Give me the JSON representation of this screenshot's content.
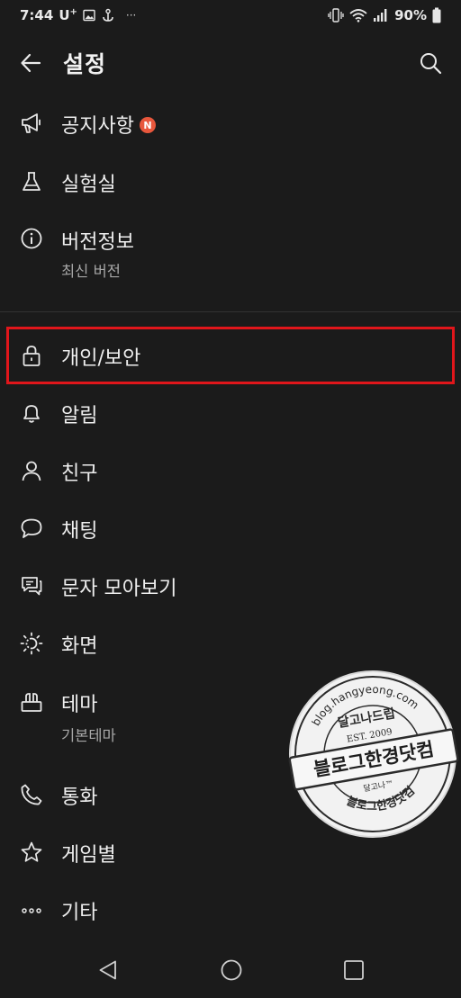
{
  "status_bar": {
    "time": "7:44",
    "carrier": "U",
    "carrier_sup": "+",
    "battery_percent": "90%",
    "dots": "···"
  },
  "header": {
    "title": "설정"
  },
  "menu": [
    {
      "label": "공지사항",
      "badge": "N",
      "icon": "megaphone-icon"
    },
    {
      "label": "실험실",
      "icon": "flask-icon"
    },
    {
      "label": "버전정보",
      "sub": "최신 버전",
      "icon": "info-icon"
    },
    {
      "label": "개인/보안",
      "icon": "lock-icon",
      "highlighted": true
    },
    {
      "label": "알림",
      "icon": "bell-icon"
    },
    {
      "label": "친구",
      "icon": "person-icon"
    },
    {
      "label": "채팅",
      "icon": "chat-bubble-icon"
    },
    {
      "label": "문자 모아보기",
      "icon": "message-collection-icon"
    },
    {
      "label": "화면",
      "icon": "brightness-icon"
    },
    {
      "label": "테마",
      "sub": "기본테마",
      "icon": "theme-brush-icon"
    },
    {
      "label": "통화",
      "icon": "phone-icon"
    },
    {
      "label": "게임별",
      "icon": "star-icon"
    },
    {
      "label": "기타",
      "icon": "more-dots-icon"
    }
  ],
  "watermark": {
    "url_text": "blog.hangyeong.com",
    "top_text": "달고나드립",
    "est": "EST. 2009",
    "banner": "블로그한경닷컴",
    "small": "달고나™",
    "bottom_text": "블로그한경닷컴"
  },
  "colors": {
    "background": "#1b1b1b",
    "highlight": "#e0161b",
    "badge": "#e8573c"
  }
}
